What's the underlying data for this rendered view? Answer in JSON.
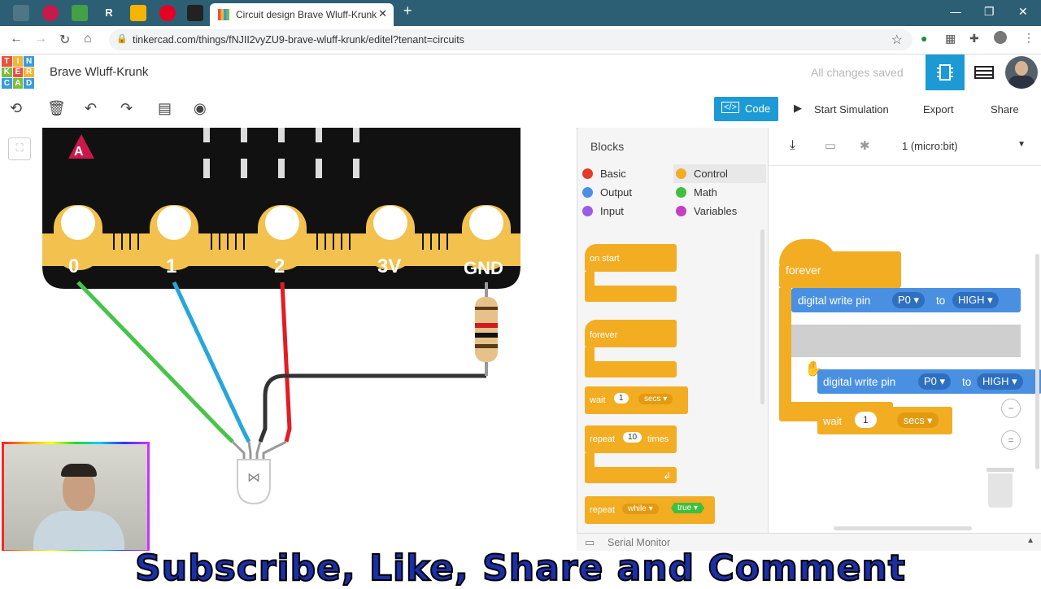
{
  "browser": {
    "active_tab_title": "Circuit design Brave Wluff-Krunk",
    "pinned_tabs": [
      "R"
    ],
    "url": "tinkercad.com/things/fNJII2vyZU9-brave-wluff-krunk/editel?tenant=circuits"
  },
  "header": {
    "logo_letters": [
      "T",
      "I",
      "N",
      "K",
      "E",
      "R",
      "C",
      "A",
      "D"
    ],
    "project_name": "Brave Wluff-Krunk",
    "save_status": "All changes saved"
  },
  "toolbar": {
    "code_label": "Code",
    "start_sim_label": "Start Simulation",
    "export_label": "Export",
    "share_label": "Share"
  },
  "canvas": {
    "board_marker": "A",
    "pins": [
      "0",
      "1",
      "2",
      "3V",
      "GND"
    ]
  },
  "code_panel": {
    "blocks_title": "Blocks",
    "categories": [
      {
        "label": "Basic",
        "color": "#e23b2e"
      },
      {
        "label": "Control",
        "color": "#f3ad23"
      },
      {
        "label": "Output",
        "color": "#4a90e2"
      },
      {
        "label": "Math",
        "color": "#3fbf3f"
      },
      {
        "label": "Input",
        "color": "#9a5ce6"
      },
      {
        "label": "Variables",
        "color": "#c43fc4"
      }
    ],
    "palette": {
      "on_start": "on start",
      "forever": "forever",
      "wait": "wait",
      "wait_val": "1",
      "wait_unit": "secs",
      "repeat": "repeat",
      "repeat_val": "10",
      "repeat_unit": "times",
      "repeat_while": "repeat",
      "while": "while",
      "true": "true"
    },
    "device_select": "1 (micro:bit)",
    "workspace": {
      "forever": "forever",
      "dwp_label": "digital write pin",
      "pin": "P0",
      "to": "to",
      "level": "HIGH",
      "wait_label": "wait",
      "wait_val": "1",
      "wait_unit": "secs",
      "wait_partial": "wai"
    },
    "serial_monitor": "Serial Monitor"
  },
  "overlay": {
    "banner_text": "Subscribe, Like, Share and Comment"
  }
}
